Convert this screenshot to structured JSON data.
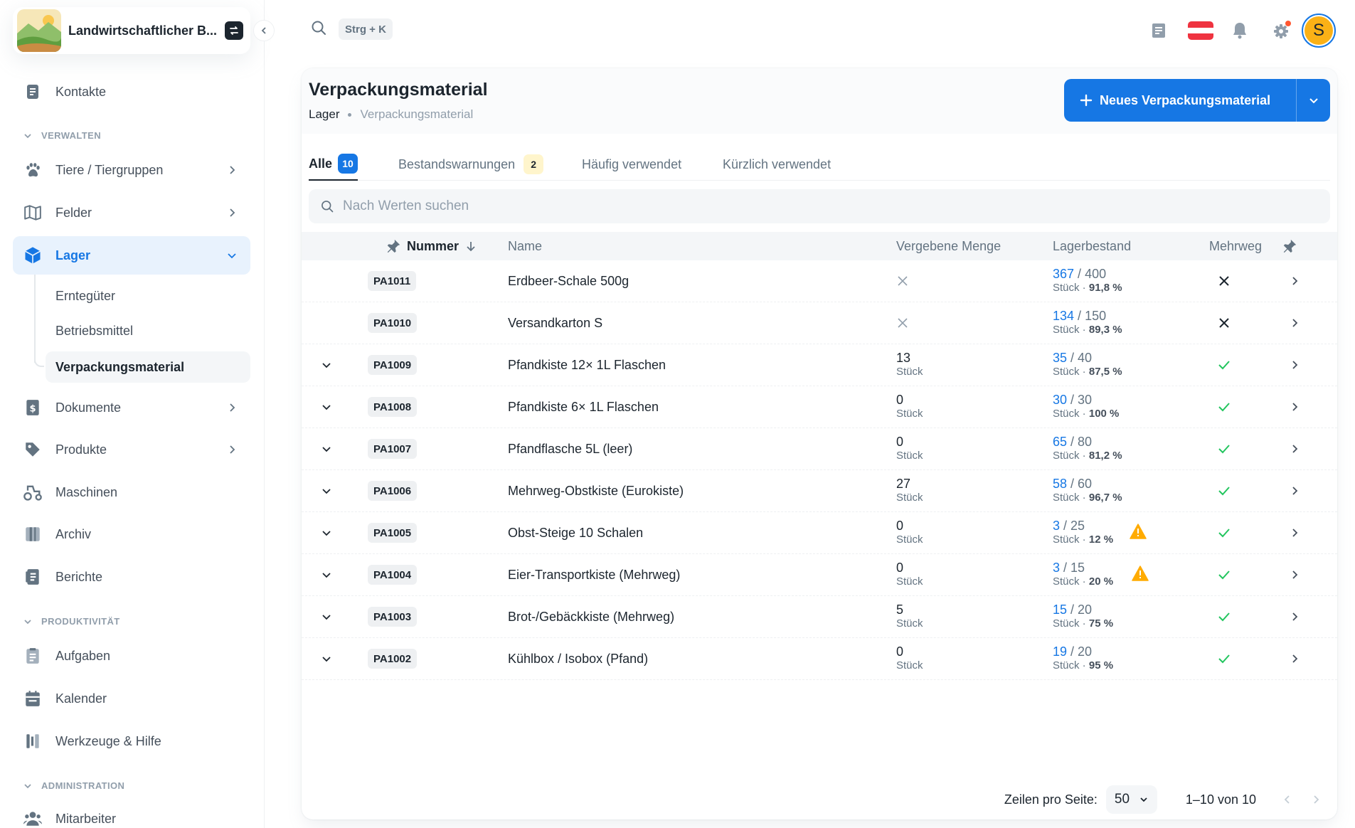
{
  "workspace": {
    "name": "Landwirtschaftlicher B..."
  },
  "sidebar": {
    "top_item": {
      "label": "Kontakte",
      "icon": "contacts-icon"
    },
    "sections": {
      "verwalten": "VERWALTEN",
      "produktivitaet": "PRODUKTIVITÄT",
      "administration": "ADMINISTRATION"
    },
    "items": [
      {
        "label": "Tiere / Tiergruppen",
        "icon": "paw-icon"
      },
      {
        "label": "Felder",
        "icon": "map-icon"
      },
      {
        "label": "Lager",
        "icon": "box-icon"
      },
      {
        "label": "Dokumente",
        "icon": "invoice-icon"
      },
      {
        "label": "Produkte",
        "icon": "tag-icon"
      },
      {
        "label": "Maschinen",
        "icon": "tractor-icon"
      },
      {
        "label": "Archiv",
        "icon": "archive-icon"
      },
      {
        "label": "Berichte",
        "icon": "report-icon"
      },
      {
        "label": "Aufgaben",
        "icon": "tasks-icon"
      },
      {
        "label": "Kalender",
        "icon": "calendar-icon"
      },
      {
        "label": "Werkzeuge & Hilfe",
        "icon": "tools-icon"
      },
      {
        "label": "Mitarbeiter",
        "icon": "users-icon"
      }
    ],
    "lager_sub": [
      "Erntegüter",
      "Betriebsmittel",
      "Verpackungsmaterial"
    ]
  },
  "topbar": {
    "shortcut": "Strg + K",
    "avatar_letter": "S"
  },
  "page": {
    "title": "Verpackungsmaterial",
    "breadcrumb": [
      "Lager",
      "Verpackungsmaterial"
    ],
    "new_button": "Neues Verpackungsmaterial"
  },
  "tabs": [
    {
      "label": "Alle",
      "count": "10"
    },
    {
      "label": "Bestandswarnungen",
      "count": "2"
    },
    {
      "label": "Häufig verwendet"
    },
    {
      "label": "Kürzlich verwendet"
    }
  ],
  "search": {
    "placeholder": "Nach Werten suchen"
  },
  "table": {
    "columns": {
      "number": "Nummer",
      "name": "Name",
      "assigned": "Vergebene Menge",
      "stock": "Lagerbestand",
      "reusable": "Mehrweg"
    },
    "unit": "Stück",
    "rows": [
      {
        "code": "PA1011",
        "name": "Erdbeer-Schale 500g",
        "assigned": null,
        "stock": "367",
        "total": "400",
        "pct": "91,8 %",
        "reusable": false,
        "warning": false
      },
      {
        "code": "PA1010",
        "name": "Versandkarton S",
        "assigned": null,
        "stock": "134",
        "total": "150",
        "pct": "89,3 %",
        "reusable": false,
        "warning": false
      },
      {
        "code": "PA1009",
        "name": "Pfandkiste 12× 1L Flaschen",
        "assigned": "13",
        "stock": "35",
        "total": "40",
        "pct": "87,5 %",
        "reusable": true,
        "warning": false
      },
      {
        "code": "PA1008",
        "name": "Pfandkiste 6× 1L Flaschen",
        "assigned": "0",
        "stock": "30",
        "total": "30",
        "pct": "100 %",
        "reusable": true,
        "warning": false
      },
      {
        "code": "PA1007",
        "name": "Pfandflasche 5L (leer)",
        "assigned": "0",
        "stock": "65",
        "total": "80",
        "pct": "81,2 %",
        "reusable": true,
        "warning": false
      },
      {
        "code": "PA1006",
        "name": "Mehrweg-Obstkiste (Eurokiste)",
        "assigned": "27",
        "stock": "58",
        "total": "60",
        "pct": "96,7 %",
        "reusable": true,
        "warning": false
      },
      {
        "code": "PA1005",
        "name": "Obst-Steige 10 Schalen",
        "assigned": "0",
        "stock": "3",
        "total": "25",
        "pct": "12 %",
        "reusable": true,
        "warning": true
      },
      {
        "code": "PA1004",
        "name": "Eier-Transportkiste (Mehrweg)",
        "assigned": "0",
        "stock": "3",
        "total": "15",
        "pct": "20 %",
        "reusable": true,
        "warning": true
      },
      {
        "code": "PA1003",
        "name": "Brot-/Gebäckkiste (Mehrweg)",
        "assigned": "5",
        "stock": "15",
        "total": "20",
        "pct": "75 %",
        "reusable": true,
        "warning": false
      },
      {
        "code": "PA1002",
        "name": "Kühlbox / Isobox (Pfand)",
        "assigned": "0",
        "stock": "19",
        "total": "20",
        "pct": "95 %",
        "reusable": true,
        "warning": false
      }
    ]
  },
  "pagination": {
    "rows_per_page_label": "Zeilen pro Seite:",
    "rows_per_page": "50",
    "range": "1–10 von 10"
  },
  "colors": {
    "primary": "#1677e4",
    "success": "#22c55e",
    "warning": "#ffab00",
    "avatar": "#fbb116"
  }
}
